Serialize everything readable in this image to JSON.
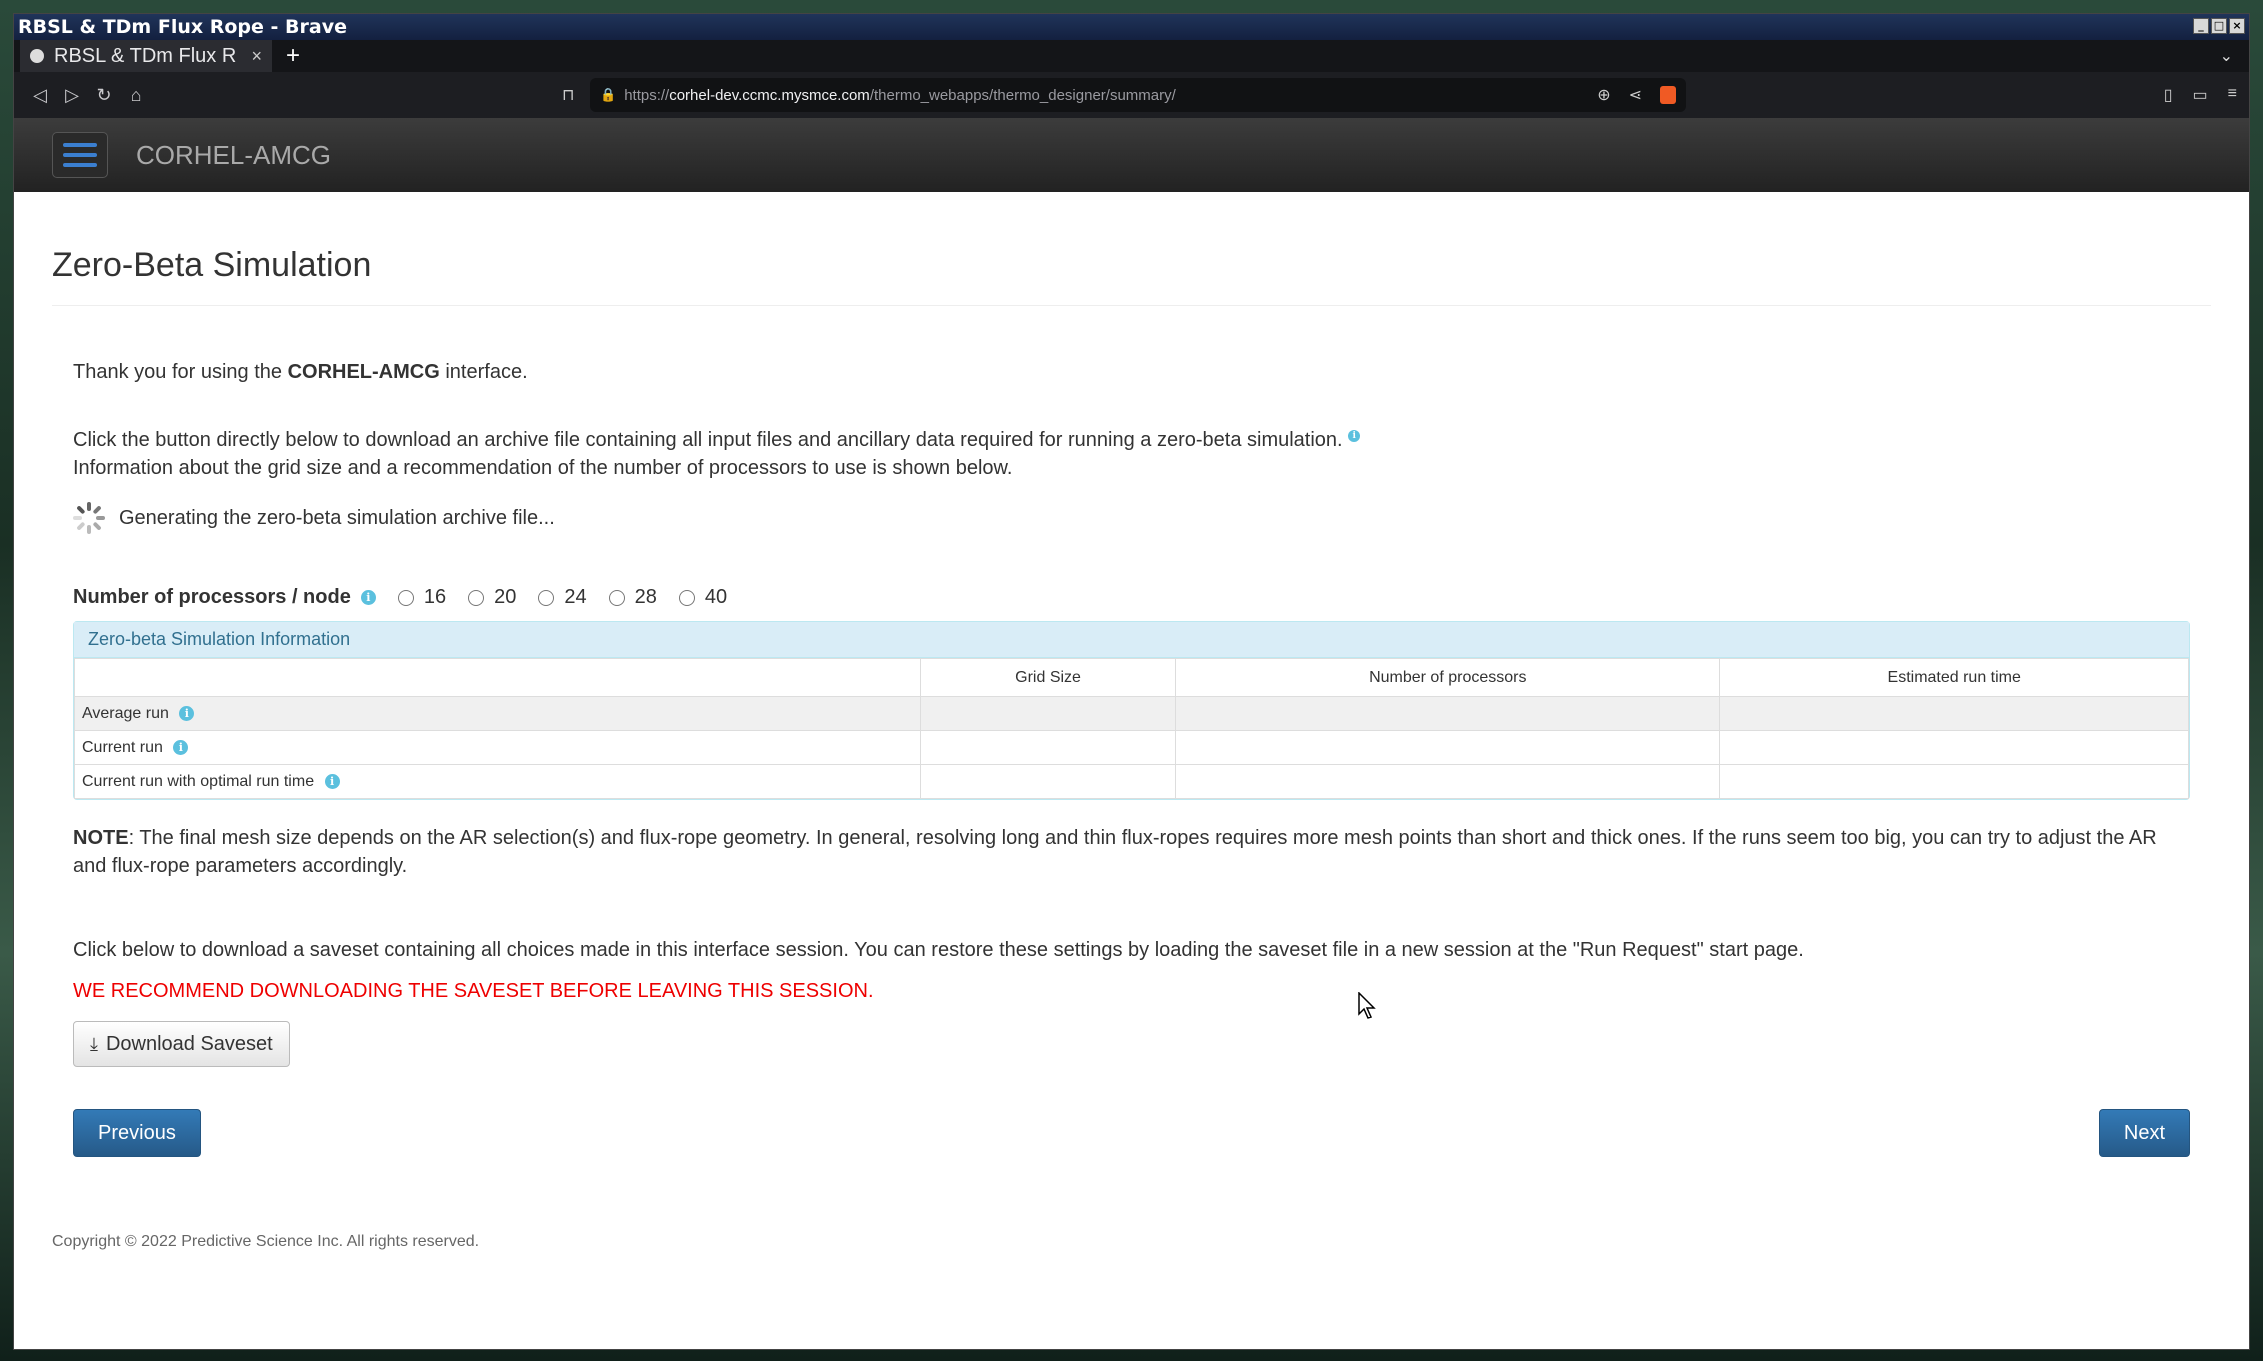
{
  "window": {
    "title": "RBSL & TDm Flux Rope - Brave"
  },
  "browser": {
    "tab_title": "RBSL & TDm Flux R",
    "url_prefix": "https://",
    "url_host": "corhel-dev.ccmc.mysmce.com",
    "url_path": "/thermo_webapps/thermo_designer/summary/"
  },
  "app": {
    "brand": "CORHEL-AMCG"
  },
  "page": {
    "title": "Zero-Beta Simulation",
    "thanks_pre": "Thank you for using the ",
    "thanks_bold": "CORHEL-AMCG",
    "thanks_post": " interface.",
    "download_line1": "Click the button directly below to download an archive file containing all input files and ancillary data required for running a zero-beta simulation.",
    "download_line2": "Information about the grid size and a recommendation of the number of processors to use is shown below.",
    "generating": "Generating the zero-beta simulation archive file...",
    "procs_label": "Number of processors / node",
    "procs_options": [
      "16",
      "20",
      "24",
      "28",
      "40"
    ],
    "panel_heading": "Zero-beta Simulation Information",
    "table_headers": [
      "",
      "Grid Size",
      "Number of processors",
      "Estimated run time"
    ],
    "table_rows": [
      "Average run",
      "Current run",
      "Current run with optimal run time"
    ],
    "note_bold": "NOTE",
    "note_text": ": The final mesh size depends on the AR selection(s) and flux-rope geometry. In general, resolving long and thin flux-ropes requires more mesh points than short and thick ones. If the runs seem too big, you can try to adjust the AR and flux-rope parameters accordingly.",
    "saveset_text": "Click below to download a saveset containing all choices made in this interface session. You can restore these settings by loading the saveset file in a new session at the \"Run Request\" start page.",
    "warning": "WE RECOMMEND DOWNLOADING THE SAVESET BEFORE LEAVING THIS SESSION.",
    "download_button": "Download Saveset",
    "previous_button": "Previous",
    "next_button": "Next",
    "footer": "Copyright © 2022 Predictive Science Inc. All rights reserved."
  },
  "colors": {
    "primary": "#337ab7",
    "warning": "#ee0000",
    "info": "#5bc0de"
  }
}
